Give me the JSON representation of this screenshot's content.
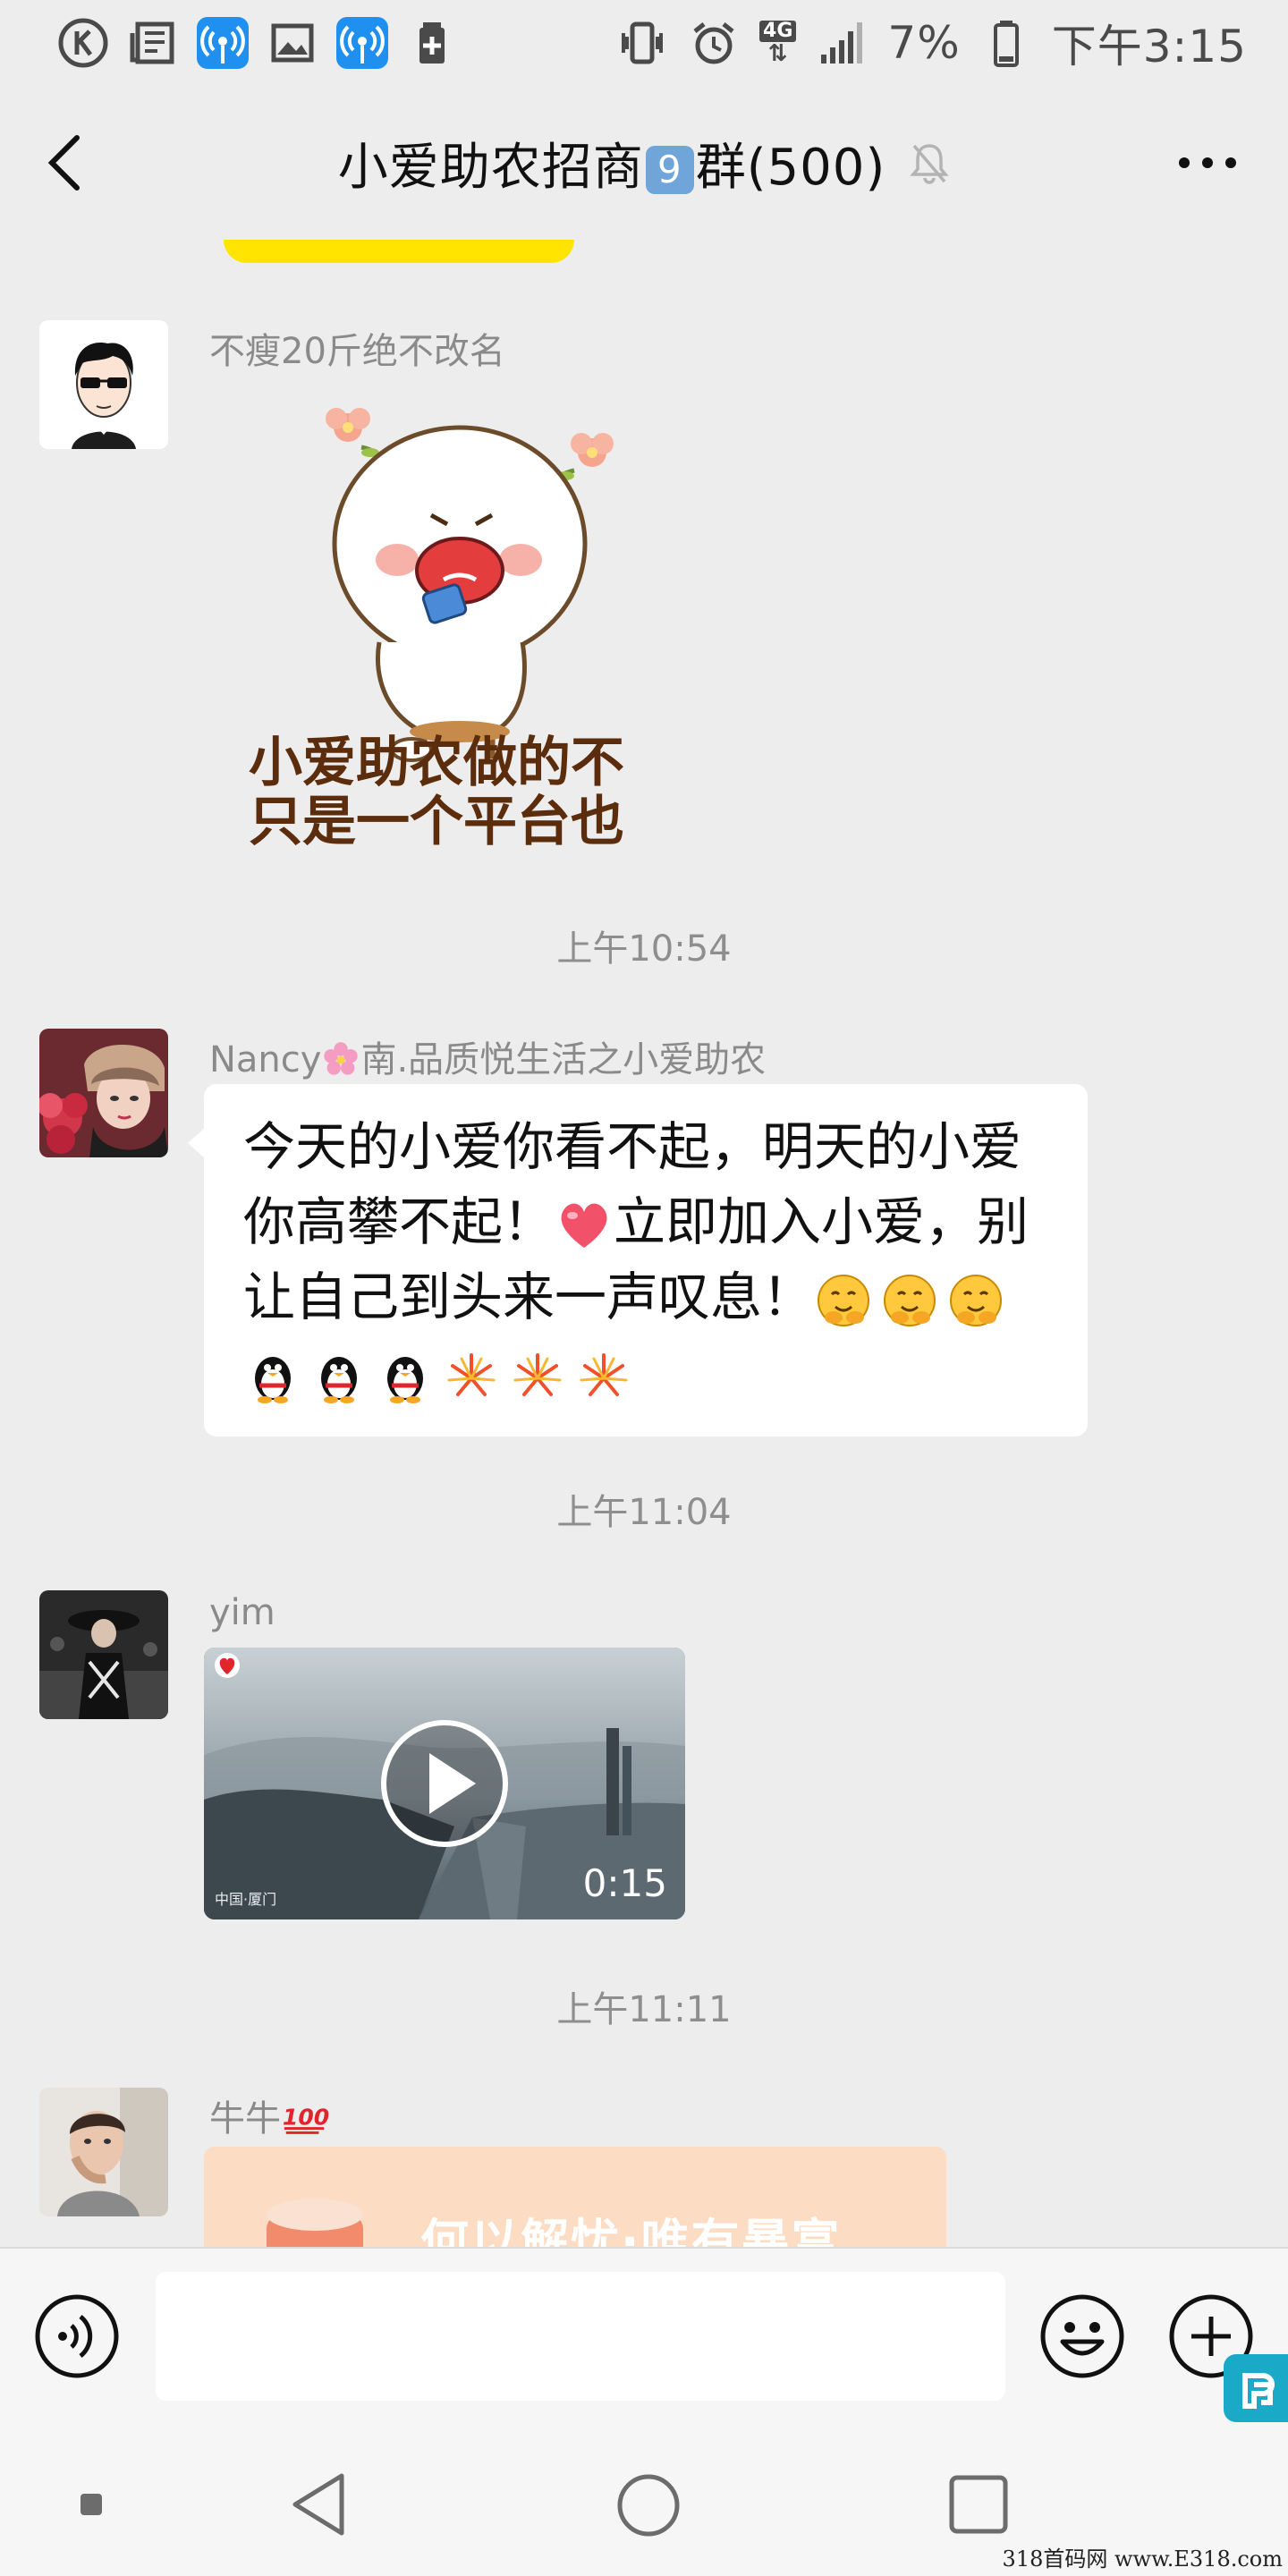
{
  "status_bar": {
    "left_icons": [
      "k-circle-icon",
      "news-icon",
      "wifi-hotspot-icon",
      "image-icon",
      "wifi-hotspot-icon",
      "battery-saver-icon"
    ],
    "network": "4G",
    "battery_percent": "7%",
    "time": "下午3:15"
  },
  "header": {
    "title_prefix": "小爱助农招商",
    "title_badge": "9",
    "title_suffix": "群(500)"
  },
  "messages": [
    {
      "type": "sticker",
      "sender": "不瘦20斤绝不改名",
      "sticker_caption_line1": "小爱助农做的不",
      "sticker_caption_line2": "只是一个平台也"
    },
    {
      "type": "time",
      "text": "上午10:54"
    },
    {
      "type": "text",
      "sender_prefix": "Nancy",
      "sender_suffix": "南.品质悦生活之小爱助农",
      "line1": "今天的小爱你看不起，明天的小爱",
      "line2_a": "你高攀不起！",
      "line2_b": "立即加入小爱，别",
      "line3": "让自己到头来一声叹息！"
    },
    {
      "type": "time",
      "text": "上午11:04"
    },
    {
      "type": "video",
      "sender": "yim",
      "duration": "0:15",
      "location_label": "中国·厦门"
    },
    {
      "type": "time",
      "text": "上午11:11"
    },
    {
      "type": "link",
      "sender": "牛牛",
      "card_text": "何以解忧·唯有暴富"
    }
  ],
  "input": {
    "value": "",
    "placeholder": ""
  },
  "watermark": "318首码网 www.E318.com",
  "colors": {
    "background": "#ededed",
    "bubble": "#ffffff",
    "link_card": "#fcdcc3",
    "accent_blue": "#1f8ff0"
  }
}
